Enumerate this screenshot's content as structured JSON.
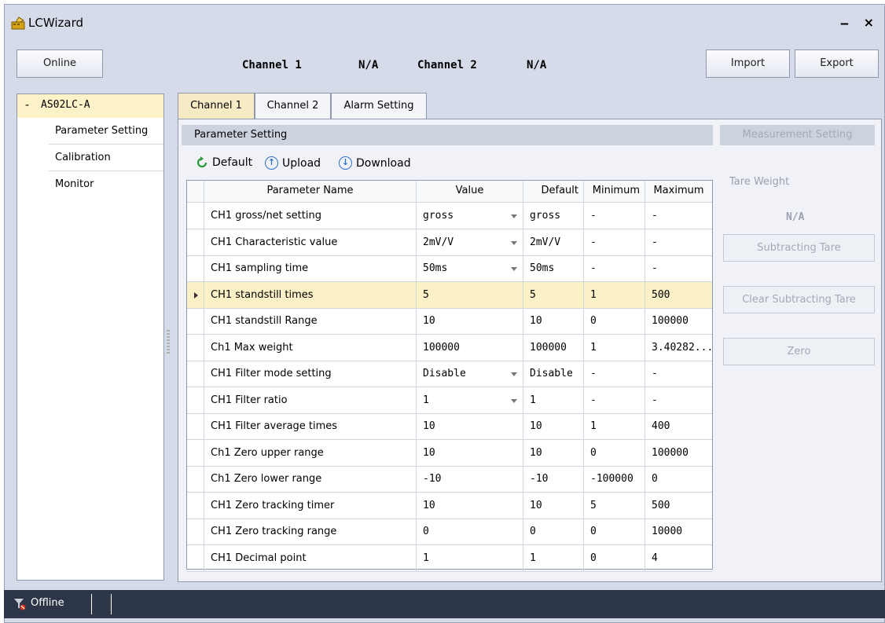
{
  "window": {
    "title": "LCWizard",
    "minimize_glyph": "‒",
    "close_glyph": "×"
  },
  "header": {
    "online_label": "Online",
    "channel1_label": "Channel 1",
    "channel1_value": "N/A",
    "channel2_label": "Channel 2",
    "channel2_value": "N/A",
    "import_label": "Import",
    "export_label": "Export"
  },
  "tree": {
    "root_label": "AS02LC-A",
    "expander": "-",
    "children": [
      "Parameter Setting",
      "Calibration",
      "Monitor"
    ]
  },
  "tabs": [
    "Channel 1",
    "Channel 2",
    "Alarm Setting"
  ],
  "section": {
    "title": "Parameter Setting"
  },
  "toolbar": {
    "default_label": "Default",
    "upload_label": "Upload",
    "download_label": "Download"
  },
  "grid": {
    "columns": [
      "Parameter Name",
      "Value",
      "Default",
      "Minimum",
      "Maximum"
    ],
    "rows": [
      {
        "name": "CH1 gross/net setting",
        "value": "gross",
        "default": "gross",
        "min": "-",
        "max": "-"
      },
      {
        "name": "CH1 Characteristic value",
        "value": "2mV/V",
        "default": "2mV/V",
        "min": "-",
        "max": "-"
      },
      {
        "name": "CH1 sampling time",
        "value": "50ms",
        "default": "50ms",
        "min": "-",
        "max": "-"
      },
      {
        "name": "CH1 standstill times",
        "value": "5",
        "default": "5",
        "min": "1",
        "max": "500"
      },
      {
        "name": "CH1 standstill Range",
        "value": "10",
        "default": "10",
        "min": "0",
        "max": "100000"
      },
      {
        "name": "Ch1 Max weight",
        "value": "100000",
        "default": "100000",
        "min": "1",
        "max": "3.40282..."
      },
      {
        "name": "CH1 Filter mode setting",
        "value": "Disable",
        "default": "Disable",
        "min": "-",
        "max": "-"
      },
      {
        "name": "CH1 Filter ratio",
        "value": "1",
        "default": "1",
        "min": "-",
        "max": "-"
      },
      {
        "name": "CH1 Filter average times",
        "value": "10",
        "default": "10",
        "min": "1",
        "max": "400"
      },
      {
        "name": "Ch1 Zero upper range",
        "value": "10",
        "default": "10",
        "min": "0",
        "max": "100000"
      },
      {
        "name": "Ch1 Zero lower range",
        "value": "-10",
        "default": "-10",
        "min": "-100000",
        "max": "0"
      },
      {
        "name": "CH1 Zero tracking timer",
        "value": "10",
        "default": "10",
        "min": "5",
        "max": "500"
      },
      {
        "name": "CH1 Zero tracking range",
        "value": "0",
        "default": "0",
        "min": "0",
        "max": "10000"
      },
      {
        "name": "CH1 Decimal point",
        "value": "1",
        "default": "1",
        "min": "0",
        "max": "4"
      }
    ]
  },
  "measurement": {
    "title": "Measurement Setting",
    "tare_weight_label": "Tare Weight",
    "tare_weight_value": "N/A",
    "subtracting_tare_label": "Subtracting Tare",
    "clear_subtracting_tare_label": "Clear Subtracting Tare",
    "zero_label": "Zero"
  },
  "status": {
    "connection": "Offline"
  },
  "colors": {
    "selected_row": "#fbf0c6",
    "status_bar": "#2c3648",
    "accent_blue": "#2e6fc8"
  }
}
